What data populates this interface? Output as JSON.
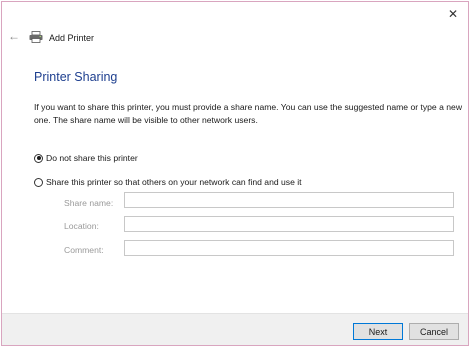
{
  "window": {
    "title": "Add Printer",
    "close_glyph": "✕",
    "back_glyph": "←",
    "back_icon": "back-arrow-icon",
    "printer_icon": "printer-icon"
  },
  "page": {
    "heading": "Printer Sharing",
    "description": "If you want to share this printer, you must provide a share name. You can use the suggested name or type a new one. The share name will be visible to other network users."
  },
  "options": {
    "do_not_share": {
      "label": "Do not share this printer",
      "selected": true
    },
    "share": {
      "label": "Share this printer so that others on your network can find and use it",
      "selected": false
    }
  },
  "fields": {
    "share_name": {
      "label": "Share name:",
      "value": ""
    },
    "location": {
      "label": "Location:",
      "value": ""
    },
    "comment": {
      "label": "Comment:",
      "value": ""
    }
  },
  "footer": {
    "next_label": "Next",
    "cancel_label": "Cancel"
  },
  "colors": {
    "heading": "#1e3f8f",
    "window_border": "#d9a5bf",
    "primary_border": "#0078d7"
  }
}
